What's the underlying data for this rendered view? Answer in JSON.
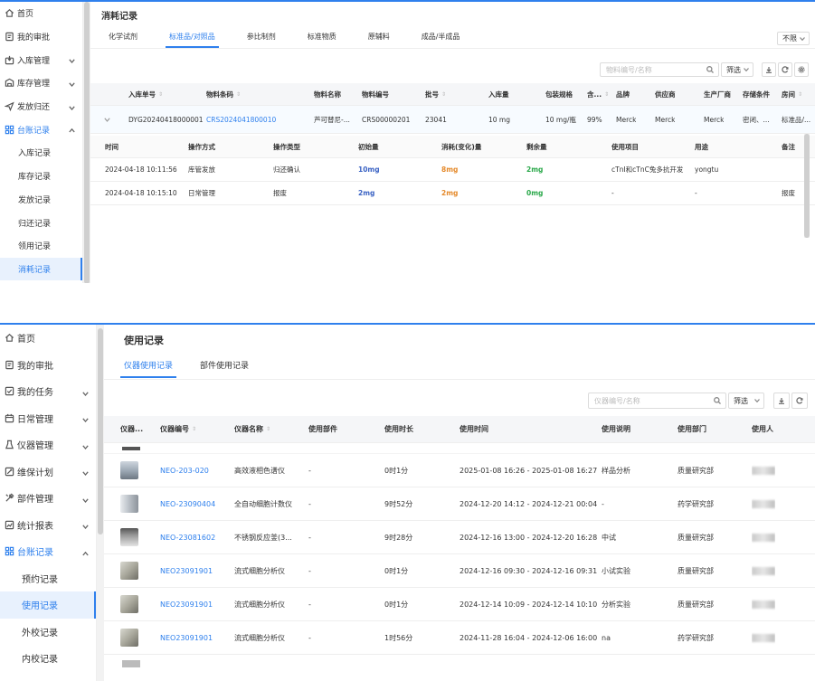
{
  "panel1": {
    "page_title": "消耗记录",
    "tabs": [
      "化学试剂",
      "标准品/对照品",
      "参比制剂",
      "标准物质",
      "原辅料",
      "成品/半成品"
    ],
    "active_tab": 1,
    "filter_select": "不限",
    "search_placeholder": "物料编号/名称",
    "filter_button": "筛选",
    "sidebar": {
      "items": [
        {
          "label": "首页",
          "icon": "home-icon",
          "expand": false
        },
        {
          "label": "我的审批",
          "icon": "approval-icon",
          "expand": false
        },
        {
          "label": "入库管理",
          "icon": "inbound-icon",
          "expand": true
        },
        {
          "label": "库存管理",
          "icon": "inventory-icon",
          "expand": true
        },
        {
          "label": "发放归还",
          "icon": "send-icon",
          "expand": true
        },
        {
          "label": "台账记录",
          "icon": "ledger-icon",
          "expand": true,
          "active": true
        }
      ],
      "sub_items": [
        "入库记录",
        "库存记录",
        "发放记录",
        "归还记录",
        "领用记录",
        "消耗记录"
      ],
      "current_sub": 5
    },
    "main_table": {
      "headers": [
        "入库单号",
        "物料条码",
        "物料名称",
        "物料编号",
        "批号",
        "入库量",
        "包装规格",
        "含...",
        "品牌",
        "供应商",
        "生产厂商",
        "存储条件",
        "房间"
      ],
      "row": [
        "DYG20240418000001",
        "CRS2024041800010",
        "芦可替尼-...",
        "CRS00000201",
        "23041",
        "10 mg",
        "10 mg/瓶",
        "99%",
        "Merck",
        "Merck",
        "Merck",
        "密闭、...",
        "标准品/..."
      ]
    },
    "sub_table": {
      "headers": [
        "时间",
        "操作方式",
        "操作类型",
        "初始量",
        "消耗(变化)量",
        "剩余量",
        "使用项目",
        "用途",
        "备注"
      ],
      "rows": [
        [
          "2024-04-18 10:11:56",
          "库管发放",
          "归还确认",
          "10mg",
          "8mg",
          "2mg",
          "cTnI和cTnC兔多抗开发",
          "yongtu",
          ""
        ],
        [
          "2024-04-18 10:15:10",
          "日常管理",
          "报废",
          "2mg",
          "2mg",
          "0mg",
          "-",
          "-",
          "报废"
        ]
      ]
    }
  },
  "panel2": {
    "page_title": "使用记录",
    "tabs": [
      "仪器使用记录",
      "部件使用记录"
    ],
    "active_tab": 0,
    "search_placeholder": "仪器编号/名称",
    "filter_button": "筛选",
    "sidebar": {
      "items": [
        {
          "label": "首页",
          "icon": "home-icon",
          "expand": false
        },
        {
          "label": "我的审批",
          "icon": "approval-icon",
          "expand": false
        },
        {
          "label": "我的任务",
          "icon": "task-icon",
          "expand": true
        },
        {
          "label": "日常管理",
          "icon": "daily-icon",
          "expand": true
        },
        {
          "label": "仪器管理",
          "icon": "instrument-icon",
          "expand": true
        },
        {
          "label": "维保计划",
          "icon": "maintenance-icon",
          "expand": true
        },
        {
          "label": "部件管理",
          "icon": "tools-icon",
          "expand": true
        },
        {
          "label": "统计报表",
          "icon": "report-icon",
          "expand": true
        },
        {
          "label": "台账记录",
          "icon": "ledger-icon",
          "expand": true,
          "active": true
        }
      ],
      "sub_items": [
        "预约记录",
        "使用记录",
        "外校记录",
        "内校记录"
      ],
      "current_sub": 1
    },
    "table": {
      "headers": [
        "仪器...",
        "仪器编号",
        "仪器名称",
        "使用部件",
        "使用时长",
        "使用时间",
        "使用说明",
        "使用部门",
        "使用人"
      ],
      "rows": [
        {
          "thumb": "instrument-a",
          "code": "NEO-203-020",
          "name": "高效液相色谱仪",
          "part": "-",
          "duration": "0时1分",
          "time": "2025-01-08 16:26 - 2025-01-08 16:27",
          "note": "样品分析",
          "dept": "质量研究部"
        },
        {
          "thumb": "instrument-b",
          "code": "NEO-23090404",
          "name": "全自动细胞计数仪",
          "part": "-",
          "duration": "9时52分",
          "time": "2024-12-20 14:12 - 2024-12-21 00:04",
          "note": "-",
          "dept": "药学研究部"
        },
        {
          "thumb": "instrument-c",
          "code": "NEO-23081602",
          "name": "不锈钢反应釜(3...",
          "part": "-",
          "duration": "9时28分",
          "time": "2024-12-16 13:00 - 2024-12-20 16:28",
          "note": "中试",
          "dept": "质量研究部"
        },
        {
          "thumb": "instrument-d",
          "code": "NEO23091901",
          "name": "流式细胞分析仪",
          "part": "-",
          "duration": "0时1分",
          "time": "2024-12-16 09:30 - 2024-12-16 09:31",
          "note": "小试实验",
          "dept": "质量研究部"
        },
        {
          "thumb": "instrument-d",
          "code": "NEO23091901",
          "name": "流式细胞分析仪",
          "part": "-",
          "duration": "0时1分",
          "time": "2024-12-14 10:09 - 2024-12-14 10:10",
          "note": "分析实验",
          "dept": "质量研究部"
        },
        {
          "thumb": "instrument-d",
          "code": "NEO23091901",
          "name": "流式细胞分析仪",
          "part": "-",
          "duration": "1时56分",
          "time": "2024-11-28 16:04 - 2024-12-06 16:00",
          "note": "na",
          "dept": "药学研究部"
        }
      ]
    }
  }
}
